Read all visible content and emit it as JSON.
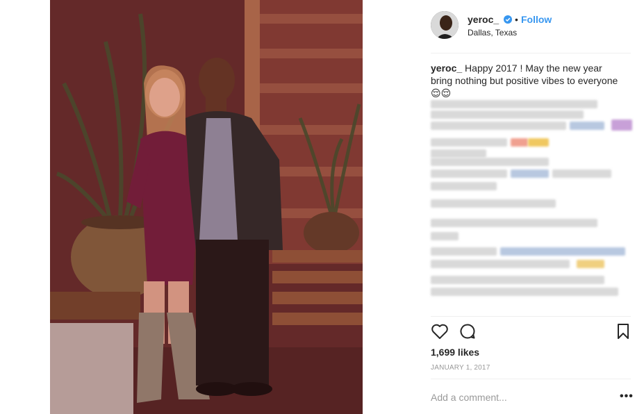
{
  "post": {
    "username": "yeroc_",
    "location": "Dallas, Texas",
    "follow_label": "Follow",
    "separator": "•",
    "caption_user": "yeroc_",
    "caption_text": " Happy 2017 ! May the new year bring nothing but positive vibes to everyone 😌😌",
    "likes": "1,699 likes",
    "date": "January 1, 2017",
    "comment_placeholder": "Add a comment...",
    "more_label": "•••"
  },
  "icons": {
    "verified": "verified-badge-icon",
    "like": "heart-icon",
    "comment": "comment-bubble-icon",
    "save": "bookmark-icon"
  },
  "colors": {
    "accent": "#3897f0",
    "text": "#262626",
    "muted": "#999999",
    "divider": "#efefef"
  }
}
